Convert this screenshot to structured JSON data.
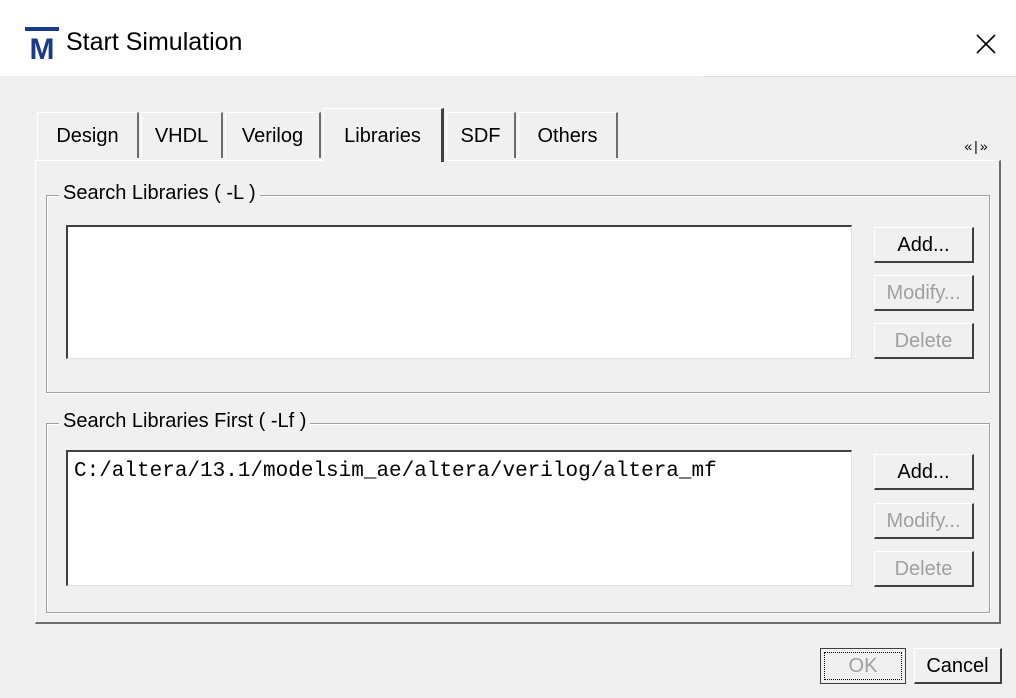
{
  "window": {
    "title": "Start Simulation",
    "app_icon_letter": "M",
    "icon_color": "#1a3a8c"
  },
  "tabs": [
    {
      "label": "Design",
      "active": false
    },
    {
      "label": "VHDL",
      "active": false
    },
    {
      "label": "Verilog",
      "active": false
    },
    {
      "label": "Libraries",
      "active": true
    },
    {
      "label": "SDF",
      "active": false
    },
    {
      "label": "Others",
      "active": false
    }
  ],
  "tab_scroll": {
    "left": "«",
    "right": "»"
  },
  "search_libraries": {
    "title": "Search Libraries ( -L )",
    "entries": [],
    "add_label": "Add...",
    "modify_label": "Modify...",
    "delete_label": "Delete"
  },
  "search_libraries_first": {
    "title": "Search Libraries First ( -Lf )",
    "entries": [
      "C:/altera/13.1/modelsim_ae/altera/verilog/altera_mf"
    ],
    "add_label": "Add...",
    "modify_label": "Modify...",
    "delete_label": "Delete"
  },
  "footer": {
    "ok_label": "OK",
    "cancel_label": "Cancel"
  }
}
